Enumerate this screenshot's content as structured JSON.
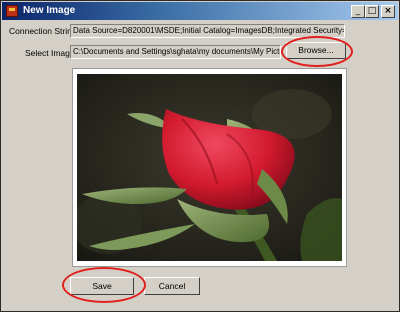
{
  "window": {
    "title": "New Image"
  },
  "titlebar": {
    "minimize_glyph": "_",
    "maximize_glyph": "□",
    "close_glyph": "×"
  },
  "form": {
    "connection_label": "Connection String :",
    "connection_value": "Data Source=D820001\\MSDE;Initial Catalog=ImagesDB;Integrated Security=SSPI;",
    "select_label": "Select Image :",
    "select_value": "C:\\Documents and Settings\\sghata\\my documents\\My Pictures\\R",
    "browse_label": "Browse...",
    "save_label": "Save",
    "cancel_label": "Cancel"
  },
  "preview": {
    "subject": "red rose bud"
  },
  "colors": {
    "titlebar_start": "#0a246a",
    "highlight_circle": "#e0201c",
    "rose": "#d21a2e",
    "window_bg": "#d4d0c8"
  },
  "icons": {
    "app": "app-icon",
    "minimize": "minimize-icon",
    "maximize": "maximize-icon",
    "close": "close-icon"
  }
}
